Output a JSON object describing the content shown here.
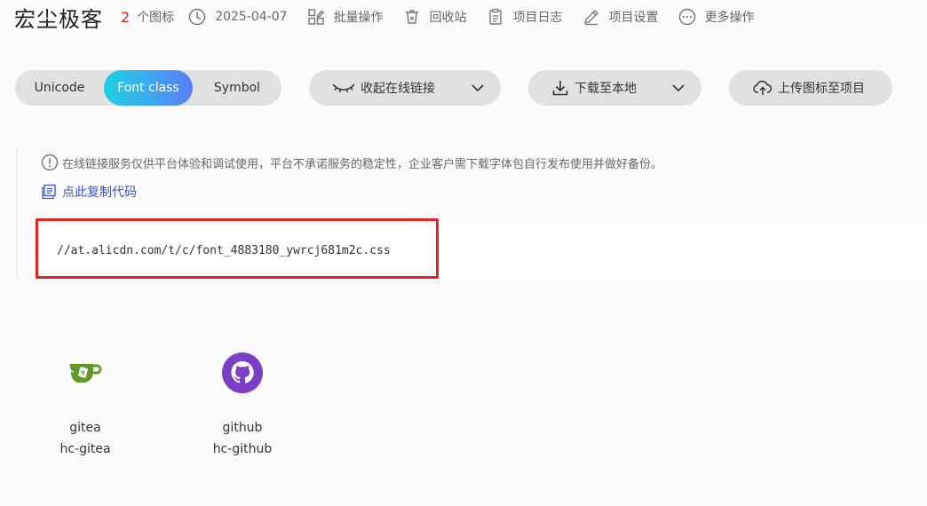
{
  "header": {
    "title": "宏尘极客",
    "icon_count": "2",
    "icon_count_label": "个图标",
    "date": "2025-04-07",
    "batch_ops": "批量操作",
    "recycle_bin": "回收站",
    "project_log": "项目日志",
    "project_settings": "项目设置",
    "more_ops": "更多操作"
  },
  "toolbar": {
    "tabs": [
      "Unicode",
      "Font class",
      "Symbol"
    ],
    "active_tab": "Font class",
    "collapse_link": "收起在线链接",
    "download": "下载至本地",
    "upload": "上传图标至项目"
  },
  "notice": {
    "text": "在线链接服务仅供平台体验和调试使用，平台不承诺服务的稳定性，企业客户需下载字体包自行发布使用并做好备份。",
    "copy_code": "点此复制代码",
    "css_url": "//at.alicdn.com/t/c/font_4883180_ywrcj681m2c.css"
  },
  "icons": [
    {
      "name": "gitea",
      "class": "hc-gitea",
      "icon": "gitea-icon",
      "color": "#609926"
    },
    {
      "name": "github",
      "class": "hc-github",
      "icon": "github-icon",
      "color": "#7b3fc6"
    }
  ],
  "colors": {
    "accent_gradient_start": "#1fd0e0",
    "accent_gradient_end": "#5a7cf4",
    "count_red": "#e02020",
    "link_blue": "#3d52c4",
    "highlight_red": "#e3231f"
  }
}
